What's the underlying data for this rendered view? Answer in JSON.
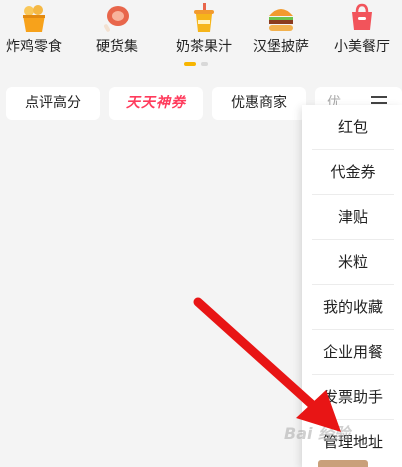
{
  "categories": [
    {
      "label": "炸鸡零食",
      "icon": "fried-chicken-icon",
      "color": "#f7a21b"
    },
    {
      "label": "硬货集",
      "icon": "meat-icon",
      "color": "#e8664b"
    },
    {
      "label": "奶茶果汁",
      "icon": "milk-tea-icon",
      "color": "#f6b51a"
    },
    {
      "label": "汉堡披萨",
      "icon": "burger-icon",
      "color": "#f29a2e"
    },
    {
      "label": "小美餐厅",
      "icon": "restaurant-icon",
      "color": "#f2545b"
    }
  ],
  "filters": {
    "chips": [
      {
        "label": "点评高分"
      },
      {
        "label": "天天神券"
      },
      {
        "label": "优惠商家"
      },
      {
        "label": "优..."
      }
    ]
  },
  "dropdown": {
    "items": [
      "红包",
      "代金券",
      "津贴",
      "米粒",
      "我的收藏",
      "企业用餐",
      "发票助手",
      "管理地址"
    ]
  },
  "colors": {
    "page_bg": "#f4f4f4",
    "arrow": "#e81515",
    "pager_active": "#f7b500"
  },
  "watermark": "Bai 经验"
}
